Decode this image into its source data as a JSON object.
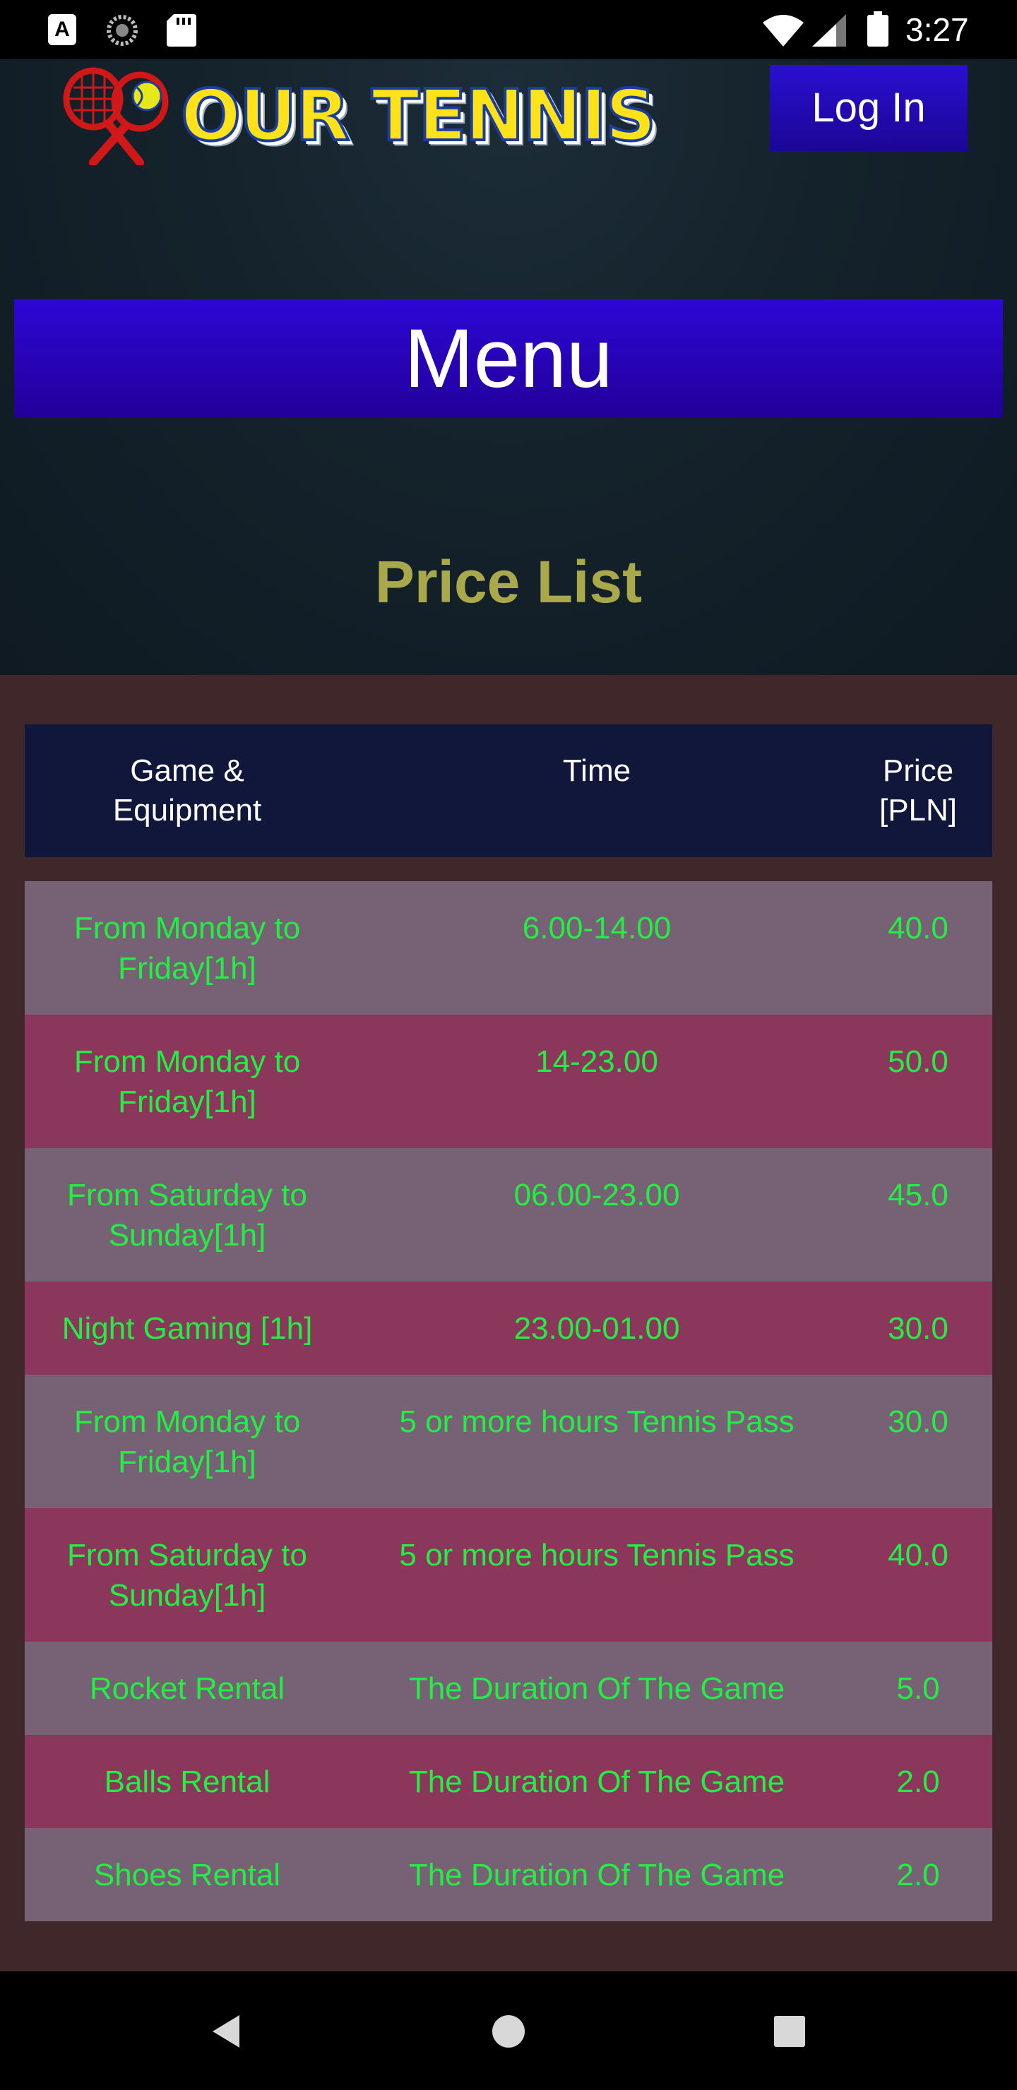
{
  "status_bar": {
    "time": "3:27",
    "icons": [
      "a-notification-icon",
      "sync-icon",
      "sd-card-icon",
      "wifi-icon",
      "signal-icon",
      "battery-icon"
    ],
    "a_glyph": "A"
  },
  "header": {
    "logo_text": "OUR TENNIS",
    "login_label": "Log In"
  },
  "menu": {
    "label": "Menu"
  },
  "price_list": {
    "title": "Price List",
    "columns": [
      "Game & Equipment",
      "Time",
      "Price [PLN]"
    ],
    "column_lines": {
      "game_1": "Game &",
      "game_2": "Equipment",
      "time": "Time",
      "price_1": "Price",
      "price_2": "[PLN]"
    },
    "rows": [
      {
        "item": "From Monday to Friday[1h]",
        "time": "6.00-14.00",
        "price": "40.0"
      },
      {
        "item": "From Monday to Friday[1h]",
        "time": "14-23.00",
        "price": "50.0"
      },
      {
        "item": "From Saturday to Sunday[1h]",
        "time": "06.00-23.00",
        "price": "45.0"
      },
      {
        "item": "Night Gaming [1h]",
        "time": "23.00-01.00",
        "price": "30.0"
      },
      {
        "item": "From Monday to Friday[1h]",
        "time": "5 or more hours Tennis Pass",
        "price": "30.0"
      },
      {
        "item": "From Saturday to Sunday[1h]",
        "time": "5 or more hours Tennis Pass",
        "price": "40.0"
      },
      {
        "item": "Rocket Rental",
        "time": "The Duration Of The Game",
        "price": "5.0"
      },
      {
        "item": "Balls Rental",
        "time": "The Duration Of The Game",
        "price": "2.0"
      },
      {
        "item": "Shoes Rental",
        "time": "The Duration Of The Game",
        "price": "2.0"
      }
    ],
    "row_colors": {
      "odd": "#776174",
      "even": "#8b375b",
      "text": "#22ee44"
    }
  },
  "colors": {
    "header_bg": "#11173a",
    "button_bg": "#2a0fd0",
    "title_color": "#a9a94c",
    "section_bg": "#40282a"
  },
  "nav_bar": {
    "buttons": [
      "back-icon",
      "home-icon",
      "recents-icon"
    ]
  }
}
